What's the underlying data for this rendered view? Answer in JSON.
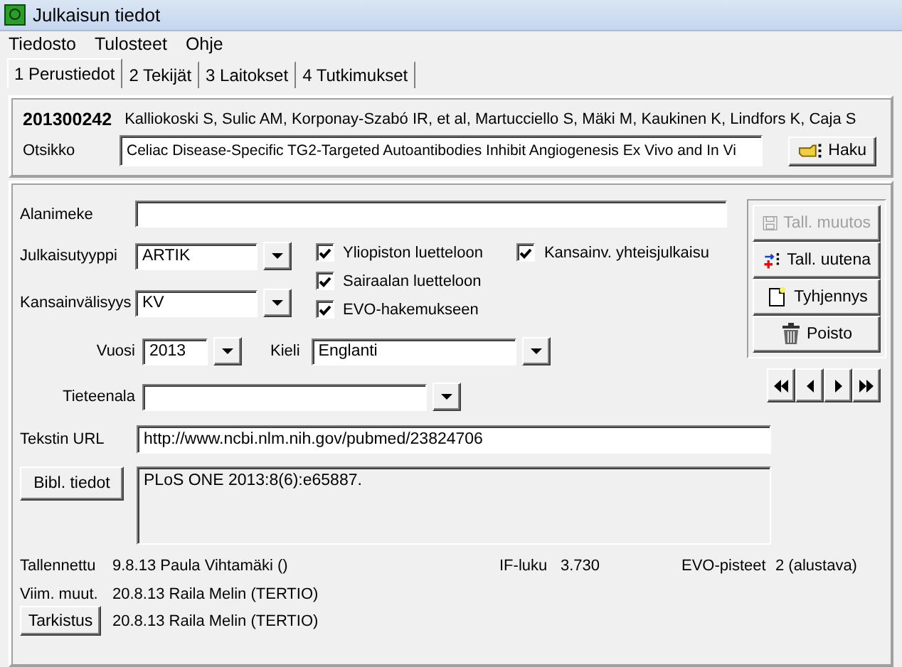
{
  "window": {
    "title": "Julkaisun tiedot"
  },
  "menu": [
    "Tiedosto",
    "Tulosteet",
    "Ohje"
  ],
  "tabs": [
    {
      "label": "1 Perustiedot",
      "selected": true
    },
    {
      "label": "2 Tekijät",
      "selected": false
    },
    {
      "label": "3 Laitokset",
      "selected": false
    },
    {
      "label": "4 Tutkimukset",
      "selected": false
    }
  ],
  "header": {
    "id": "201300242",
    "authors": "Kalliokoski S, Sulic AM, Korponay-Szabó IR, et al, Martucciello S, Mäki M, Kaukinen K, Lindfors K, Caja S",
    "title_label": "Otsikko",
    "title_value": "Celiac Disease-Specific TG2-Targeted Autoantibodies Inhibit Angiogenesis Ex Vivo and In Vi",
    "search_button": "Haku"
  },
  "subtitle": {
    "label": "Alanimeke"
  },
  "type": {
    "label": "Julkaisutyyppi",
    "value": "ARTIK"
  },
  "internationality": {
    "label": "Kansainvälisyys",
    "value": "KV"
  },
  "checkboxes": [
    {
      "label": "Yliopiston luetteloon",
      "checked": true
    },
    {
      "label": "Sairaalan luetteloon",
      "checked": true
    },
    {
      "label": "EVO-hakemukseen",
      "checked": true
    }
  ],
  "joint_publication": {
    "label": "Kansainv. yhteisjulkaisu",
    "checked": true
  },
  "year": {
    "label": "Vuosi",
    "value": "2013"
  },
  "language": {
    "label": "Kieli",
    "value": "Englanti"
  },
  "field_of_science": {
    "label": "Tieteenala"
  },
  "actions": [
    {
      "label": "Tall. muutos",
      "kind": "save",
      "disabled": true
    },
    {
      "label": "Tall. uutena",
      "kind": "new",
      "disabled": false
    },
    {
      "label": "Tyhjennys",
      "kind": "clear",
      "disabled": false
    },
    {
      "label": "Poisto",
      "kind": "delete",
      "disabled": false
    }
  ],
  "url": {
    "label": "Tekstin URL",
    "value": "http://www.ncbi.nlm.nih.gov/pubmed/23824706"
  },
  "bibl": {
    "button": "Bibl. tiedot",
    "value": "PLoS  ONE 2013:8(6):e65887."
  },
  "saved": {
    "label": "Tallennettu",
    "value": "9.8.13 Paula Vihtamäki ()"
  },
  "impact": {
    "label": "IF-luku",
    "value": "3.730"
  },
  "evo": {
    "label": "EVO-pisteet",
    "value": "2 (alustava)"
  },
  "modified": {
    "label": "Viim. muut.",
    "value": "20.8.13 Raila Melin (TERTIO)"
  },
  "check": {
    "button": "Tarkistus",
    "value": "20.8.13 Raila Melin (TERTIO)"
  }
}
